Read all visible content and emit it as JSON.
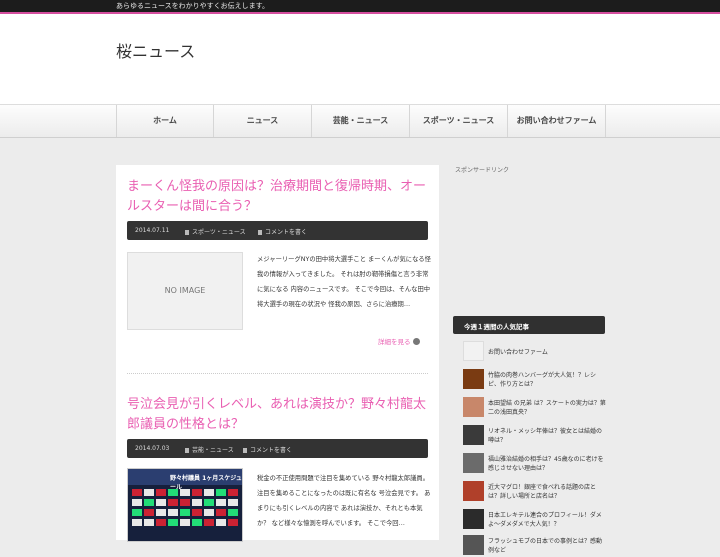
{
  "topbar": {
    "tagline": "あらゆるニュースをわかりやすくお伝えします。"
  },
  "header": {
    "site_title": "桜ニュース"
  },
  "nav": {
    "items": [
      "ホーム",
      "ニュース",
      "芸能・ニュース",
      "スポーツ・ニュース",
      "お問い合わせファーム"
    ]
  },
  "posts": [
    {
      "title": "まーくん怪我の原因は？治療期間と復帰時期、オールスターは間に合う？",
      "date": "2014.07.11",
      "category": "スポーツ・ニュース",
      "comment": "コメントを書く",
      "thumbnail_text": "NO IMAGE",
      "excerpt": "メジャーリーグNYの田中将大選手こと まーくんが気になる怪我の情報が入ってきました。 それは肘の靭帯損傷と言う非常に気になる 内容のニュースです。 そこで今回は、そんな田中将大選手の現在の状況や 怪我の原因、さらに治療期…",
      "read_more": "詳細を見る"
    },
    {
      "title": "号泣会見が引くレベル、あれは演技か？野々村龍太郎議員の性格とは？",
      "date": "2014.07.03",
      "category": "芸能・ニュース",
      "comment": "コメントを書く",
      "thumbnail_text": "野々村議員 1ヶ月スケジュール",
      "excerpt": "税金の不正使用問題で注目を集めている 野々村龍太郎議員。 注目を集めることになったのは既に有名な 号泣会見です。 あまりにも引くレベルの内容で あれは演技か、それとも本気か？ など様々な憶測を呼んでいます。 そこで今回…"
    }
  ],
  "sidebar": {
    "sponsored_label": "スポンサードリンク",
    "popular_title": "今週１週間の人気記事",
    "popular_items": [
      "お問い合わせファーム",
      "竹脇の肉巻ハンバーグが大人気！？レシピ、作り方とは？",
      "本田望結 の兄弟 は？スケートの実力は？第二の浅田真央？",
      "リオネル・メッシ年俸は？彼女とは結婚の噂は？",
      "福山雅治結婚の相手は？45歳なのに老けを感じさせない理由は？",
      "近大マグロ！銀座で食べれる話題の店とは？詳しい場所と店名は？",
      "日本エレキテル連合のプロフィール！ダメよ〜ダメダメで大人気！？",
      "フラッシュモブの日本での事例とは？感動例など"
    ]
  }
}
